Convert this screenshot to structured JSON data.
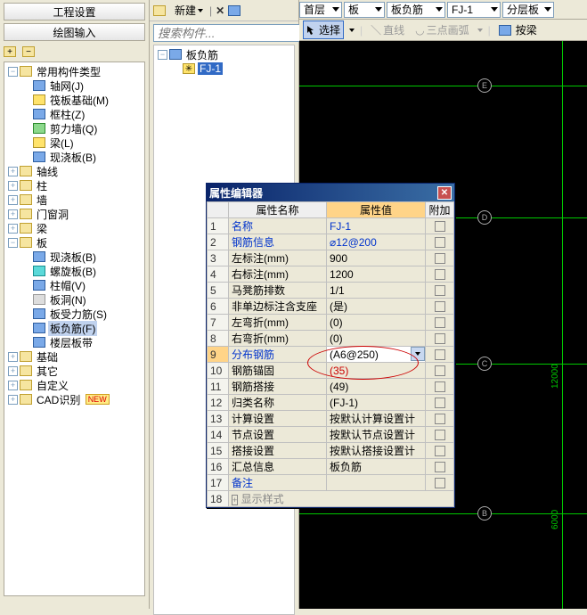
{
  "left": {
    "panel1": "工程设置",
    "panel2": "绘图输入",
    "root": "常用构件类型",
    "n1": "轴网(J)",
    "n2": "筏板基础(M)",
    "n3": "框柱(Z)",
    "n4": "剪力墙(Q)",
    "n5": "梁(L)",
    "n6": "现浇板(B)",
    "g1": "轴线",
    "g2": "柱",
    "g3": "墙",
    "g4": "门窗洞",
    "g5": "梁",
    "g6": "板",
    "g7": "基础",
    "g8": "其它",
    "g9": "自定义",
    "g10": "CAD识别",
    "p1": "现浇板(B)",
    "p2": "螺旋板(B)",
    "p3": "柱帽(V)",
    "p4": "板洞(N)",
    "p5": "板受力筋(S)",
    "p6": "板负筋(F)",
    "p7": "楼层板带",
    "new": "NEW"
  },
  "mid": {
    "newLabel": "新建",
    "searchPlaceholder": "搜索构件...",
    "root": "板负筋",
    "item": "FJ-1"
  },
  "rt": {
    "floor": "首层",
    "c1": "板",
    "c2": "板负筋",
    "c3": "FJ-1",
    "c4": "分层板",
    "select": "选择",
    "line": "直线",
    "arc": "三点画弧",
    "ext": "按梁"
  },
  "canvas": {
    "nE": "E",
    "nD": "D",
    "nC": "C",
    "nB": "B",
    "dim1": "12000",
    "dim2": "6000"
  },
  "dlg": {
    "title": "属性编辑器",
    "h1": "属性名称",
    "h2": "属性值",
    "h3": "附加",
    "rows": [
      {
        "n": "名称",
        "v": "FJ-1",
        "blue": true
      },
      {
        "n": "钢筋信息",
        "v": "⌀12@200",
        "blue": true
      },
      {
        "n": "左标注(mm)",
        "v": "900",
        "blue": false
      },
      {
        "n": "右标注(mm)",
        "v": "1200",
        "blue": false
      },
      {
        "n": "马凳筋排数",
        "v": "1/1",
        "blue": false
      },
      {
        "n": "非单边标注含支座",
        "v": "(是)",
        "blue": false
      },
      {
        "n": "左弯折(mm)",
        "v": "(0)",
        "blue": false
      },
      {
        "n": "右弯折(mm)",
        "v": "(0)",
        "blue": false
      },
      {
        "n": "分布钢筋",
        "v": "(A6@250)",
        "blue": true,
        "edit": true
      },
      {
        "n": "钢筋锚固",
        "v": "(35)",
        "blue": false
      },
      {
        "n": "钢筋搭接",
        "v": "(49)",
        "blue": false
      },
      {
        "n": "归类名称",
        "v": "(FJ-1)",
        "blue": false
      },
      {
        "n": "计算设置",
        "v": "按默认计算设置计",
        "blue": false
      },
      {
        "n": "节点设置",
        "v": "按默认节点设置计",
        "blue": false
      },
      {
        "n": "搭接设置",
        "v": "按默认搭接设置计",
        "blue": false
      },
      {
        "n": "汇总信息",
        "v": "板负筋",
        "blue": false
      },
      {
        "n": "备注",
        "v": "",
        "blue": true
      }
    ],
    "displayStyle": "显示样式"
  }
}
